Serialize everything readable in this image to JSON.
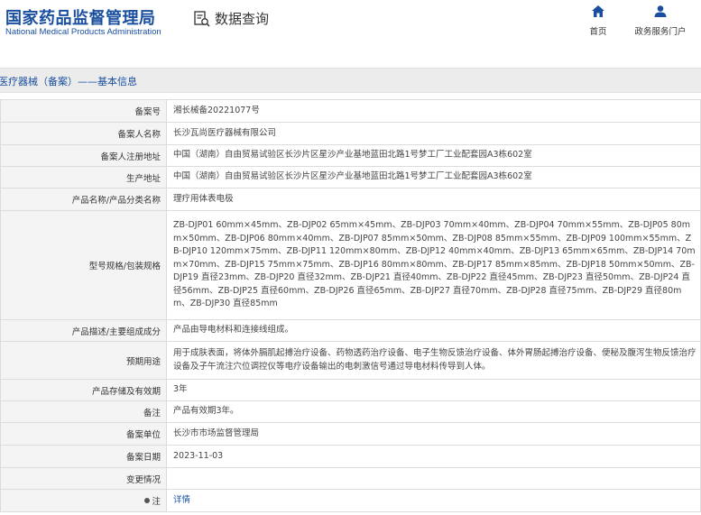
{
  "header": {
    "logo_cn": "国家药品监督管理局",
    "logo_en": "National Medical Products Administration",
    "query_label": "数据查询",
    "nav_home": "首页",
    "nav_service": "政务服务门户"
  },
  "breadcrumb": "医疗器械（备案）——基本信息",
  "rows": [
    {
      "label": "备案号",
      "value": "湘长械备20221077号"
    },
    {
      "label": "备案人名称",
      "value": "长沙瓦尚医疗器械有限公司"
    },
    {
      "label": "备案人注册地址",
      "value": "中国（湖南）自由贸易试验区长沙片区星沙产业基地蓝田北路1号梦工厂工业配套园A3栋602室"
    },
    {
      "label": "生产地址",
      "value": "中国（湖南）自由贸易试验区长沙片区星沙产业基地蓝田北路1号梦工厂工业配套园A3栋602室"
    },
    {
      "label": "产品名称/产品分类名称",
      "value": "理疗用体表电极"
    },
    {
      "label": "型号规格/包装规格",
      "value": "ZB-DJP01 60mm×45mm、ZB-DJP02 65mm×45mm、ZB-DJP03 70mm×40mm、ZB-DJP04 70mm×55mm、ZB-DJP05 80mm×50mm、ZB-DJP06 80mm×40mm、ZB-DJP07 85mm×50mm、ZB-DJP08 85mm×55mm、ZB-DJP09 100mm×55mm、ZB-DJP10 120mm×75mm、ZB-DJP11 120mm×80mm、ZB-DJP12 40mm×40mm、ZB-DJP13 65mm×65mm、ZB-DJP14 70mm×70mm、ZB-DJP15 75mm×75mm、ZB-DJP16 80mm×80mm、ZB-DJP17 85mm×85mm、ZB-DJP18 50mm×50mm、ZB-DJP19 直径23mm、ZB-DJP20 直径32mm、ZB-DJP21 直径40mm、ZB-DJP22 直径45mm、ZB-DJP23 直径50mm、ZB-DJP24 直径56mm、ZB-DJP25 直径60mm、ZB-DJP26 直径65mm、ZB-DJP27 直径70mm、ZB-DJP28 直径75mm、ZB-DJP29 直径80mm、ZB-DJP30 直径85mm"
    },
    {
      "label": "产品描述/主要组成成分",
      "value": "产品由导电材料和连接线组成。"
    },
    {
      "label": "预期用途",
      "value": "用于成肤表面，将体外膈肌起搏治疗设备、药物透药治疗设备、电子生物反馈治疗设备、体外胃肠起搏治疗设备、便秘及腹泻生物反馈治疗设备及子午流注穴位调控仪等电疗设备输出的电刺激信号通过导电材料传导到人体。"
    },
    {
      "label": "产品存储及有效期",
      "value": "3年"
    },
    {
      "label": "备注",
      "value": "产品有效期3年。"
    },
    {
      "label": "备案单位",
      "value": "长沙市市场监督管理局"
    },
    {
      "label": "备案日期",
      "value": "2023-11-03"
    },
    {
      "label": "变更情况",
      "value": ""
    },
    {
      "label": "注",
      "value": "详情"
    }
  ],
  "colors": {
    "brand_blue": "#1a4fa0",
    "label_bg": "#f4f4f4",
    "breadcrumb_bg": "#ececec"
  },
  "icons": {
    "query": "search-document-icon",
    "home": "home-icon",
    "service": "user-icon",
    "note": "pin-icon"
  }
}
